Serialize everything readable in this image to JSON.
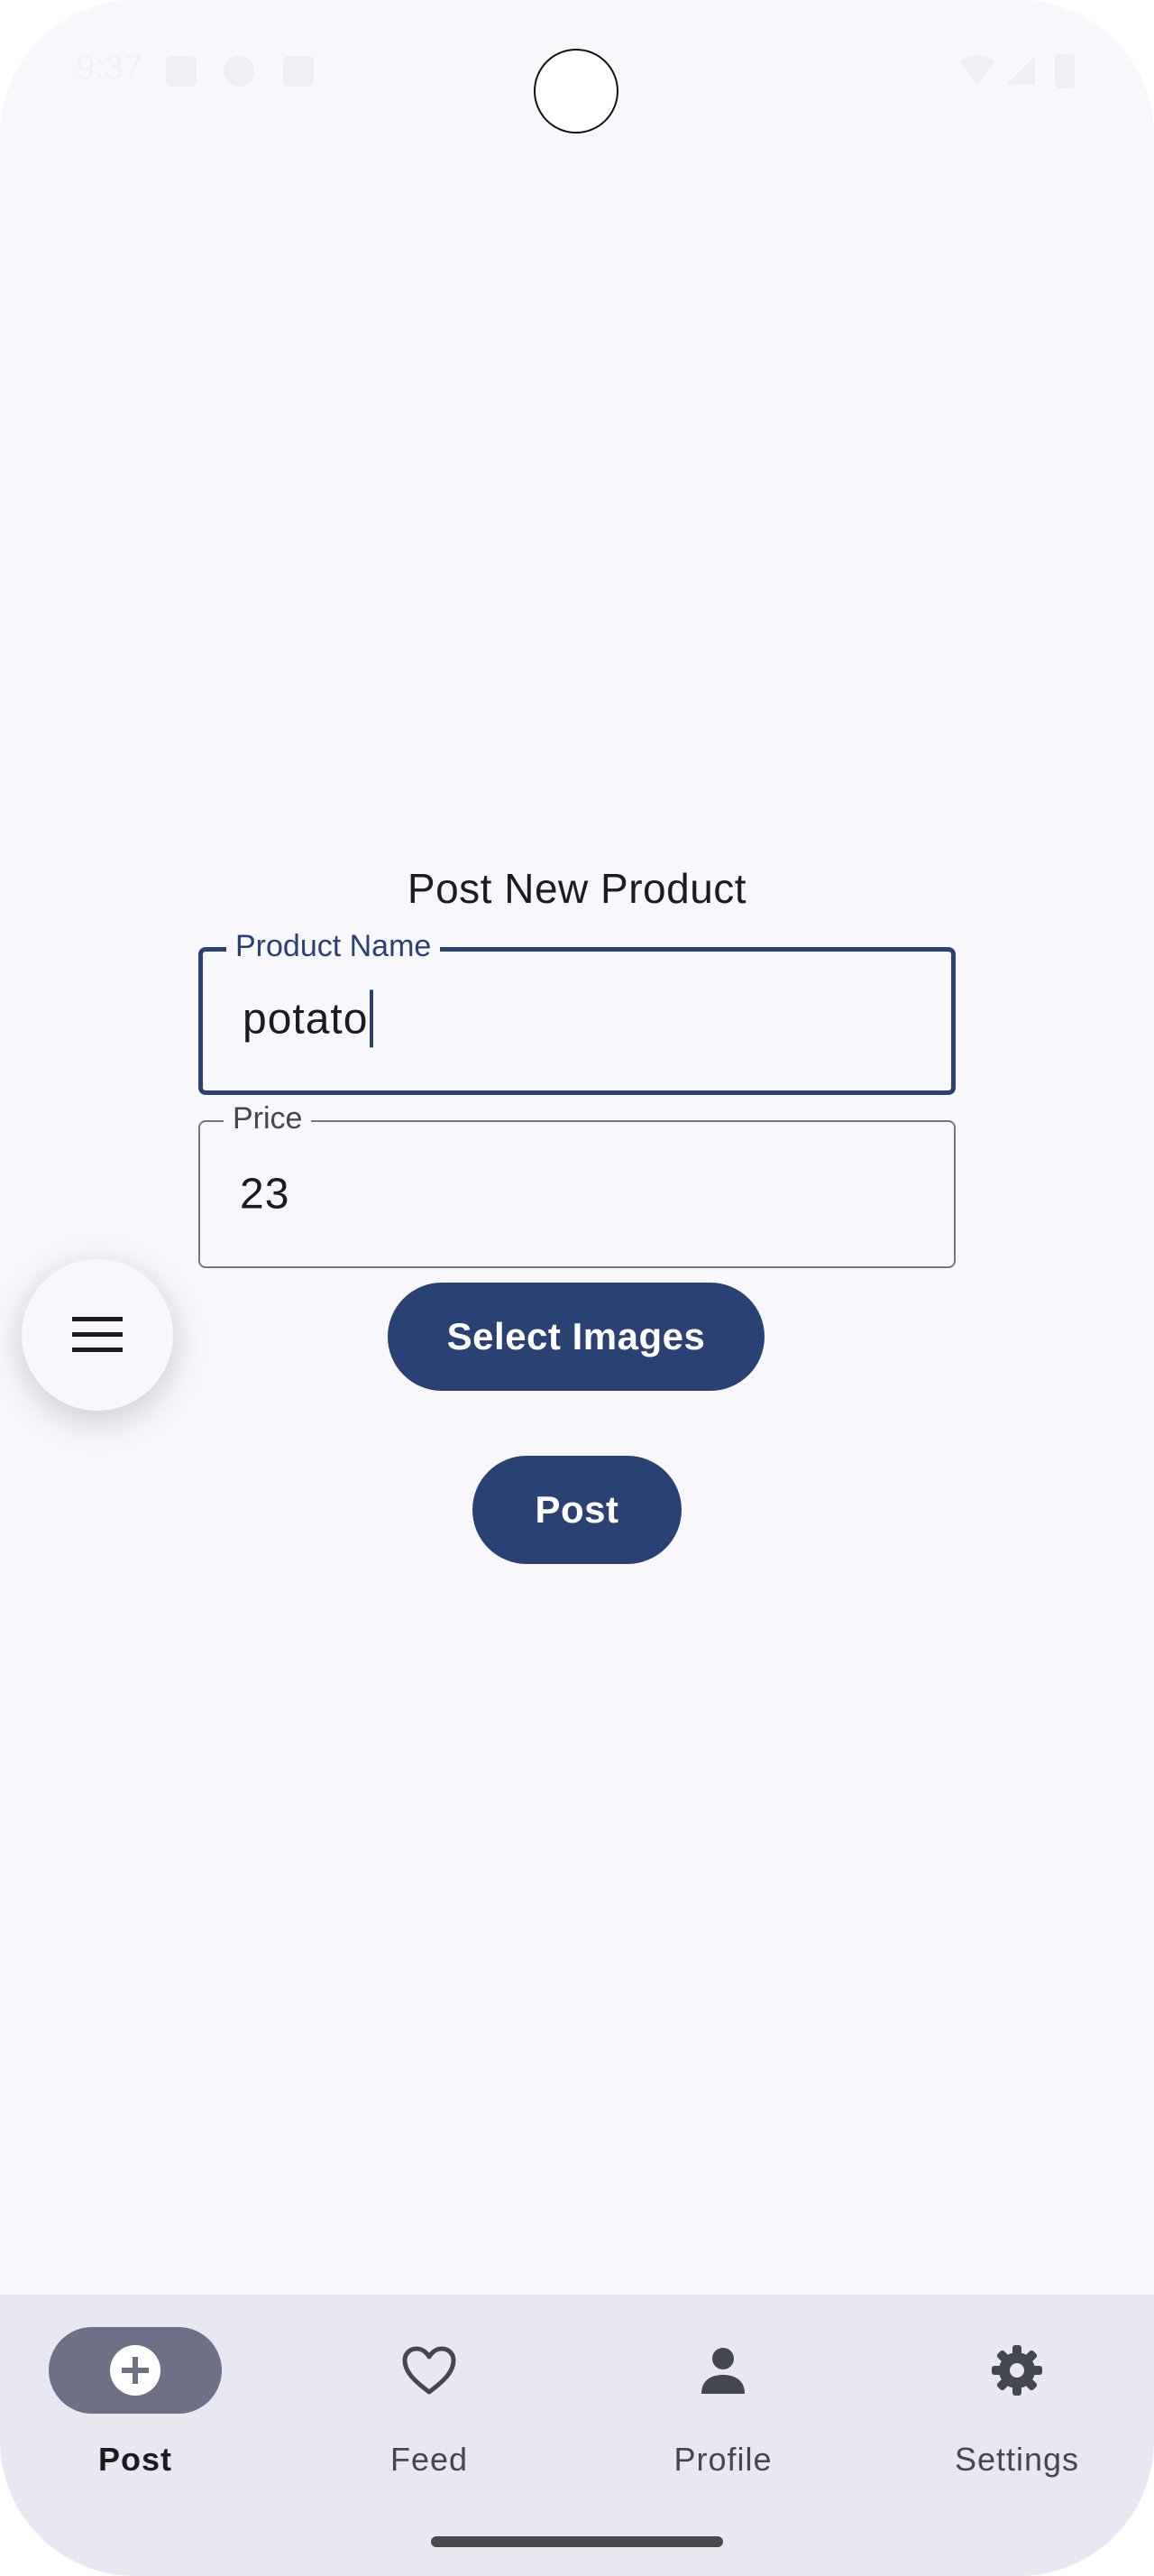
{
  "status_bar": {
    "time": "9:37"
  },
  "form": {
    "title": "Post New Product",
    "product_name": {
      "label": "Product Name",
      "value": "potato"
    },
    "price": {
      "label": "Price",
      "value": "23"
    },
    "select_images_label": "Select Images",
    "post_label": "Post"
  },
  "fab": {
    "icon": "menu-icon"
  },
  "bottom_nav": {
    "items": [
      {
        "label": "Post",
        "icon": "add-circle-icon",
        "active": true
      },
      {
        "label": "Feed",
        "icon": "heart-icon",
        "active": false
      },
      {
        "label": "Profile",
        "icon": "person-icon",
        "active": false
      },
      {
        "label": "Settings",
        "icon": "gear-icon",
        "active": false
      }
    ]
  },
  "colors": {
    "primary": "#2a4273",
    "background": "#f7f7fc",
    "nav_background": "#e8e8f2",
    "active_pill": "#6e7185"
  }
}
